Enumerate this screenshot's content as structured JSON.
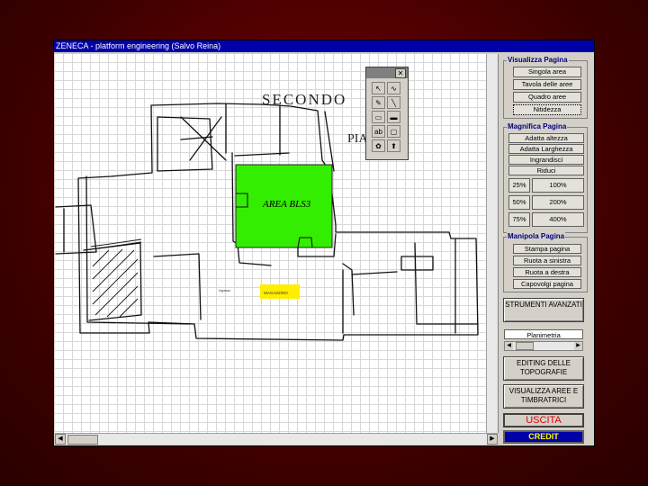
{
  "window": {
    "title": "ZENECA - platform engineering (Salvo Reina)"
  },
  "drawing": {
    "handwritten_title_line1": "SECONDO",
    "handwritten_title_line2": "PIANO",
    "area_label": "AREA BLS3",
    "small_label": "MAGAZZINO",
    "tiny_label": "ingresso",
    "area_color": "#33ee00",
    "small_color": "#ffee00"
  },
  "panel": {
    "visualizza": {
      "title": "Visualizza Pagina",
      "buttons": [
        "Singola area",
        "Tavola delle aree",
        "Quadro aree",
        "Nitidezza"
      ]
    },
    "magnifica": {
      "title": "Magnifica Pagina",
      "buttons": [
        "Adatta altezza",
        "Adatta Larghezza",
        "Ingrandisci",
        "Riduci"
      ],
      "zoom": [
        "25%",
        "100%",
        "50%",
        "200%",
        "75%",
        "400%"
      ]
    },
    "manipola": {
      "title": "Manipola Pagina",
      "buttons": [
        "Stampa pagina",
        "Ruota a sinistra",
        "Ruota a destra",
        "Capovolgi pagina"
      ]
    },
    "strumenti": "STRUMENTI AVANZATI",
    "selector_value": "Planimetria",
    "editing": "EDITING DELLE TOPOGRAFIE",
    "visualizza_aree": "VISUALIZZA AREE E TIMBRATRICI",
    "uscita": "USCITA",
    "credit": "CREDIT"
  },
  "colors": {
    "titlebar": "#0000a8",
    "uscita": "#e00000",
    "credit_bg": "#0000a8",
    "credit_text": "#ffff00"
  }
}
